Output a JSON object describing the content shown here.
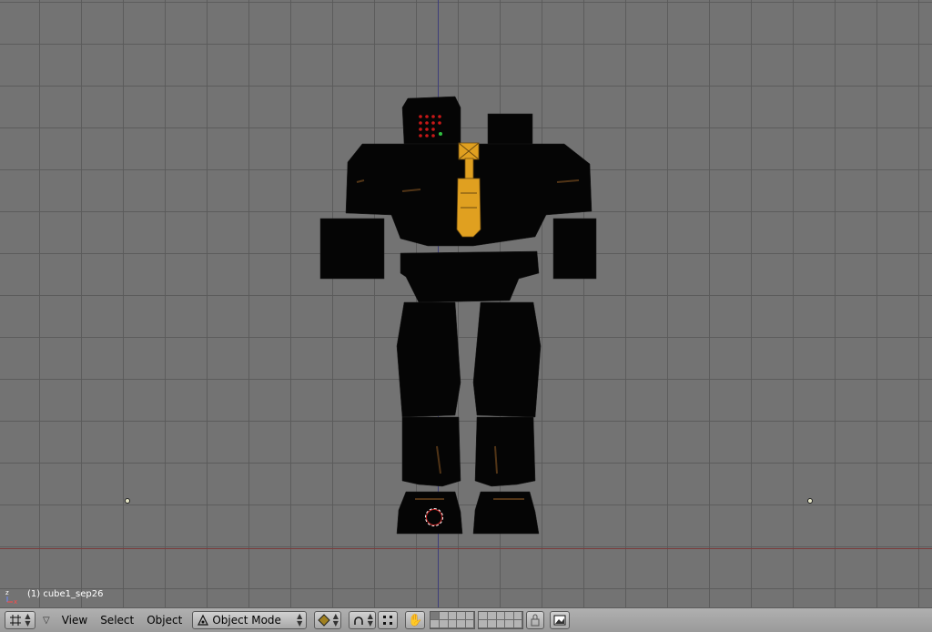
{
  "viewport": {
    "object_label": "(1) cube1_sep26",
    "axis_labels": {
      "z": "z",
      "x": "x"
    }
  },
  "header": {
    "editor_type_icon": "grid-viewport-icon",
    "menus": [
      "View",
      "Select",
      "Object"
    ],
    "mode": "Object Mode",
    "icons": [
      "shading-icon",
      "pivot-icon",
      "snap-icon",
      "hand-icon",
      "lock-icon",
      "render-icon"
    ]
  },
  "colors": {
    "viewport_bg": "#737373",
    "grid": "#5a5a5a",
    "robot_body": "#050505",
    "robot_accent": "#e0a020",
    "header_bg": "#a8a8a8"
  }
}
